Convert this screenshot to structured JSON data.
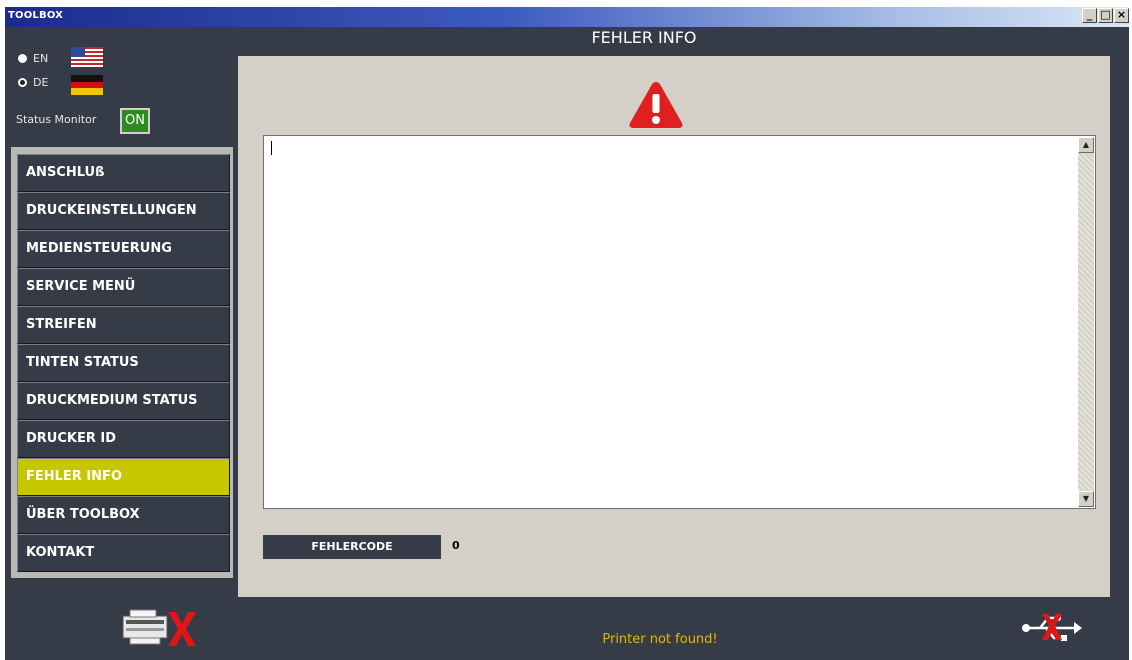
{
  "window": {
    "title": "TOOLBOX",
    "controls": [
      "_",
      "□",
      "×"
    ]
  },
  "language": [
    {
      "code": "EN",
      "selected": false
    },
    {
      "code": "DE",
      "selected": true
    }
  ],
  "status_monitor": {
    "label": "Status Monitor",
    "state": "ON"
  },
  "nav": {
    "items": [
      {
        "label": "ANSCHLUß",
        "active": false
      },
      {
        "label": "DRUCKEINSTELLUNGEN",
        "active": false
      },
      {
        "label": "MEDIENSTEUERUNG",
        "active": false
      },
      {
        "label": "SERVICE MENÜ",
        "active": false
      },
      {
        "label": "STREIFEN",
        "active": false
      },
      {
        "label": "TINTEN STATUS",
        "active": false
      },
      {
        "label": "DRUCKMEDIUM STATUS",
        "active": false
      },
      {
        "label": "DRUCKER ID",
        "active": false
      },
      {
        "label": "FEHLER INFO",
        "active": true
      },
      {
        "label": "ÜBER TOOLBOX",
        "active": false
      },
      {
        "label": "KONTAKT",
        "active": false
      }
    ]
  },
  "main": {
    "title": "FEHLER INFO",
    "error_text": "",
    "error_code_label": "FEHLERCODE",
    "error_code_value": "0"
  },
  "footer": {
    "status": "Printer not found!"
  },
  "icons": {
    "warning": "warning-icon",
    "printer": "printer-disconnected-icon",
    "usb": "usb-disconnected-icon"
  },
  "colors": {
    "background": "#353b47",
    "accent": "#c7c700",
    "status_on": "#2e8b22",
    "warning_red": "#e02020",
    "footer_text": "#e6b800"
  }
}
